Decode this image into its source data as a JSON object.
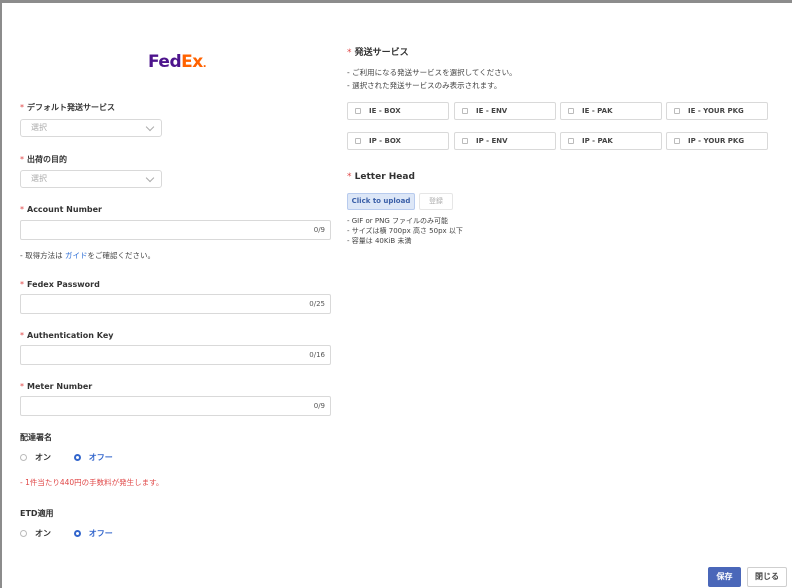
{
  "logo": {
    "fed": "Fed",
    "ex": "Ex",
    "dot": "."
  },
  "default_service": {
    "label": "デフォルト発送サービス",
    "placeholder": "選択"
  },
  "shipment_purpose": {
    "label": "出荷の目的",
    "placeholder": "選択"
  },
  "account_number": {
    "label": "Account Number",
    "count": "0/9"
  },
  "guide_hint": {
    "prefix": "- 取得方法は",
    "link": "ガイド",
    "suffix": "をご確認ください。"
  },
  "fedex_password": {
    "label": "Fedex Password",
    "count": "0/25"
  },
  "auth_key": {
    "label": "Authentication Key",
    "count": "0/16"
  },
  "meter_number": {
    "label": "Meter Number",
    "count": "0/9"
  },
  "delivery_signature": {
    "label": "配達署名",
    "options": [
      "オン",
      "オフー"
    ],
    "selected": "オフー",
    "note": "- 1件当たり440円の手数料が発生します。"
  },
  "etd": {
    "label": "ETD適用",
    "options": [
      "オン",
      "オフー"
    ],
    "selected": "オフー"
  },
  "shipping_services": {
    "title": "発送サービス",
    "desc1": "- ご利用になる発送サービスを選択してください。",
    "desc2": "- 選択された発送サービスのみ表示されます。",
    "row1": [
      "IE - BOX",
      "IE - ENV",
      "IE - PAK",
      "IE - YOUR PKG"
    ],
    "row2": [
      "IP - BOX",
      "IP - ENV",
      "IP - PAK",
      "IP - YOUR PKG"
    ]
  },
  "letter_head": {
    "title": "Letter Head",
    "upload_label": "Click to upload",
    "register_label": "登録",
    "notes": [
      "- GIF or PNG ファイルのみ可能",
      "- サイズは横 700px 高さ 50px 以下",
      "- 容量は 40KiB 未満"
    ]
  },
  "footer": {
    "save_label": "保存",
    "close_label": "閉じる"
  },
  "colors": {
    "accent": "#4a67b9",
    "required": "#e04848",
    "link": "#2f6fd6"
  }
}
